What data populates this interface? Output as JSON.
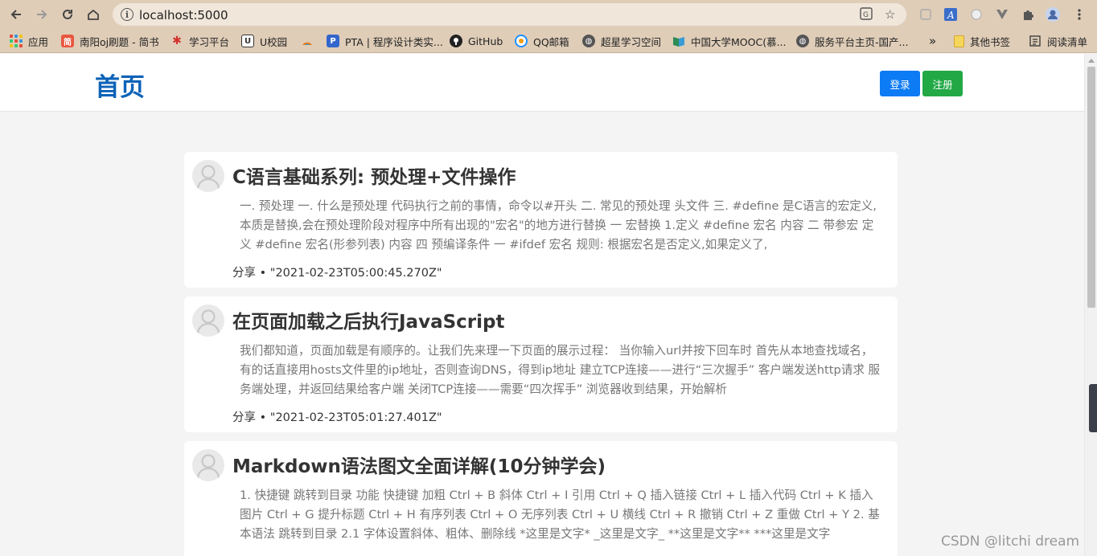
{
  "browser": {
    "url": "localhost:5000",
    "bookmarks": [
      {
        "label": "应用",
        "icon": "apps-grid-icon"
      },
      {
        "label": "南阳oj刷题 - 简书",
        "icon": "jianshu-icon",
        "color": "#e9573f"
      },
      {
        "label": "学习平台",
        "icon": "study-platform-icon",
        "color": "#d2322d"
      },
      {
        "label": "U校园",
        "icon": "u-campus-icon",
        "color": "#333333"
      },
      {
        "label": "",
        "icon": "fan-icon",
        "color": "#e67e22"
      },
      {
        "label": "PTA | 程序设计类实...",
        "icon": "pta-icon",
        "color": "#3366cc"
      },
      {
        "label": "GitHub",
        "icon": "github-icon",
        "color": "#222222"
      },
      {
        "label": "QQ邮箱",
        "icon": "qq-mail-icon",
        "color": "#1e90ff"
      },
      {
        "label": "超星学习空间",
        "icon": "globe-icon",
        "color": "#555555"
      },
      {
        "label": "中国大学MOOC(慕...",
        "icon": "mooc-icon",
        "color": "#2e8b57"
      },
      {
        "label": "服务平台主页-国产...",
        "icon": "globe-icon",
        "color": "#555555"
      },
      {
        "label": "»",
        "icon": "more-bookmarks-icon"
      },
      {
        "label": "其他书签",
        "icon": "folder-icon",
        "color": "#f5c542"
      },
      {
        "label": "阅读清单",
        "icon": "reading-list-icon"
      }
    ]
  },
  "header": {
    "title": "首页",
    "login_label": "登录",
    "register_label": "注册"
  },
  "posts": [
    {
      "title": "C语言基础系列: 预处理+文件操作",
      "summary": "一. 预处理 一. 什么是预处理 代码执行之前的事情，命令以#开头 二. 常见的预处理 头文件 三. #define 是C语言的宏定义,本质是替换,会在预处理阶段对程序中所有出现的\"宏名\"的地方进行替换 一 宏替换 1.定义 #define 宏名 内容 二 带参宏 定义 #define 宏名(形参列表) 内容 四 预编译条件 一 #ifdef 宏名 规则: 根据宏名是否定义,如果定义了,",
      "meta": "分享 • \"2021-02-23T05:00:45.270Z\""
    },
    {
      "title": "在页面加载之后执行JavaScript",
      "summary": "我们都知道，页面加载是有顺序的。让我们先来理一下页面的展示过程： 当你输入url并按下回车时 首先从本地查找域名，有的话直接用hosts文件里的ip地址，否则查询DNS，得到ip地址 建立TCP连接——进行“三次握手” 客户端发送http请求 服务端处理，并返回结果给客户端 关闭TCP连接——需要“四次挥手” 浏览器收到结果，开始解析",
      "meta": "分享 • \"2021-02-23T05:01:27.401Z\""
    },
    {
      "title": "Markdown语法图文全面详解(10分钟学会)",
      "summary": "1. 快捷键 跳转到目录 功能 快捷键 加粗 Ctrl + B 斜体 Ctrl + I 引用 Ctrl + Q 插入链接 Ctrl + L 插入代码 Ctrl + K 插入图片 Ctrl + G 提升标题 Ctrl + H 有序列表 Ctrl + O 无序列表 Ctrl + U 横线 Ctrl + R 撤销 Ctrl + Z 重做 Ctrl + Y 2. 基本语法 跳转到目录 2.1 字体设置斜体、粗体、删除线 *这里是文字* _这里是文字_ **这里是文字** ***这里是文字",
      "meta": ""
    }
  ],
  "watermark": "CSDN @litchi dream",
  "colors": {
    "chrome": "#dfcdb8",
    "brand_blue": "#0d63b8",
    "login_blue": "#0d7bf4",
    "register_green": "#22a946"
  }
}
